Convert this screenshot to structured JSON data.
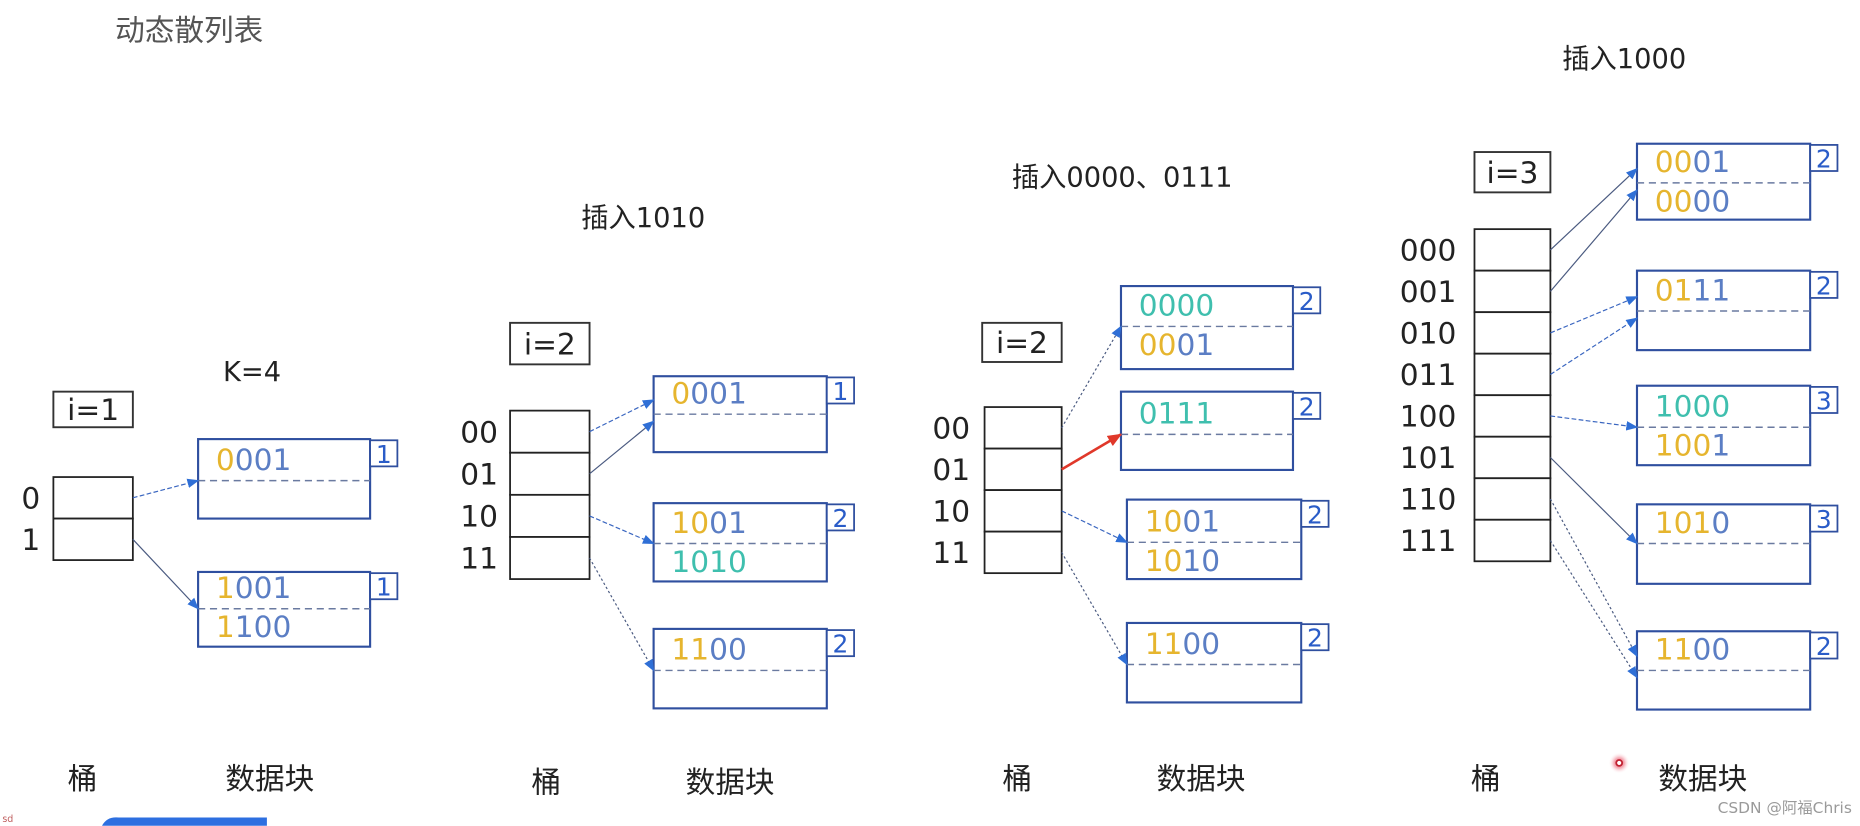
{
  "title": "动态散列表",
  "colors": {
    "prefix_bits": "#e6b52e",
    "other_bits": "#5b7ec4",
    "new_record": "#3fbfae",
    "block_border": "#2f4f9f",
    "depth_text": "#2a5cc8",
    "arrow": "#2f6fd6",
    "highlight_arrow": "#e0382a",
    "bucket_border": "#222222"
  },
  "panels": [
    {
      "title": "K=4",
      "global_depth": "i=1",
      "bucket_caption": "桶",
      "block_caption": "数据块",
      "buckets": [
        "0",
        "1"
      ],
      "blocks": [
        {
          "depth": "1",
          "records": [
            {
              "slot": 0,
              "segments": [
                {
                  "t": "0",
                  "c": "prefix"
                },
                {
                  "t": "001",
                  "c": "other"
                }
              ]
            }
          ]
        },
        {
          "depth": "1",
          "records": [
            {
              "slot": 0,
              "segments": [
                {
                  "t": "1",
                  "c": "prefix"
                },
                {
                  "t": "001",
                  "c": "other"
                }
              ]
            },
            {
              "slot": 1,
              "segments": [
                {
                  "t": "1",
                  "c": "prefix"
                },
                {
                  "t": "100",
                  "c": "other"
                }
              ]
            }
          ]
        }
      ],
      "pointers": [
        {
          "bucket": 0,
          "block": 0,
          "style": "dashed"
        },
        {
          "bucket": 1,
          "block": 1,
          "style": "solid"
        }
      ]
    },
    {
      "title": "插入1010",
      "global_depth": "i=2",
      "bucket_caption": "桶",
      "block_caption": "数据块",
      "buckets": [
        "00",
        "01",
        "10",
        "11"
      ],
      "blocks": [
        {
          "depth": "1",
          "records": [
            {
              "slot": 0,
              "segments": [
                {
                  "t": "0",
                  "c": "prefix"
                },
                {
                  "t": "001",
                  "c": "other"
                }
              ]
            }
          ]
        },
        {
          "depth": "2",
          "records": [
            {
              "slot": 0,
              "segments": [
                {
                  "t": "10",
                  "c": "prefix"
                },
                {
                  "t": "01",
                  "c": "other"
                }
              ]
            },
            {
              "slot": 1,
              "segments": [
                {
                  "t": "1010",
                  "c": "new"
                }
              ]
            }
          ]
        },
        {
          "depth": "2",
          "records": [
            {
              "slot": 0,
              "segments": [
                {
                  "t": "11",
                  "c": "prefix"
                },
                {
                  "t": "00",
                  "c": "other"
                }
              ]
            }
          ]
        }
      ],
      "pointers": [
        {
          "bucket": 0,
          "block": 0,
          "style": "dashed"
        },
        {
          "bucket": 1,
          "block": 0,
          "style": "solid"
        },
        {
          "bucket": 2,
          "block": 1,
          "style": "dashed"
        },
        {
          "bucket": 3,
          "block": 2,
          "style": "dotted"
        }
      ]
    },
    {
      "title": "插入0000、0111",
      "global_depth": "i=2",
      "bucket_caption": "桶",
      "block_caption": "数据块",
      "buckets": [
        "00",
        "01",
        "10",
        "11"
      ],
      "blocks": [
        {
          "depth": "2",
          "records": [
            {
              "slot": 0,
              "segments": [
                {
                  "t": "0000",
                  "c": "new"
                }
              ]
            },
            {
              "slot": 1,
              "segments": [
                {
                  "t": "00",
                  "c": "prefix"
                },
                {
                  "t": "01",
                  "c": "other"
                }
              ]
            }
          ]
        },
        {
          "depth": "2",
          "records": [
            {
              "slot": 0,
              "segments": [
                {
                  "t": "0111",
                  "c": "new"
                }
              ]
            }
          ]
        },
        {
          "depth": "2",
          "records": [
            {
              "slot": 0,
              "segments": [
                {
                  "t": "10",
                  "c": "prefix"
                },
                {
                  "t": "01",
                  "c": "other"
                }
              ]
            },
            {
              "slot": 1,
              "segments": [
                {
                  "t": "10",
                  "c": "prefix"
                },
                {
                  "t": "10",
                  "c": "other"
                }
              ]
            }
          ]
        },
        {
          "depth": "2",
          "records": [
            {
              "slot": 0,
              "segments": [
                {
                  "t": "11",
                  "c": "prefix"
                },
                {
                  "t": "00",
                  "c": "other"
                }
              ]
            }
          ]
        }
      ],
      "pointers": [
        {
          "bucket": 0,
          "block": 0,
          "style": "dotted"
        },
        {
          "bucket": 1,
          "block": 1,
          "style": "highlight"
        },
        {
          "bucket": 2,
          "block": 2,
          "style": "dashed"
        },
        {
          "bucket": 3,
          "block": 3,
          "style": "dotted"
        }
      ]
    },
    {
      "title": "插入1000",
      "global_depth": "i=3",
      "bucket_caption": "桶",
      "block_caption": "数据块",
      "buckets": [
        "000",
        "001",
        "010",
        "011",
        "100",
        "101",
        "110",
        "111"
      ],
      "blocks": [
        {
          "depth": "2",
          "records": [
            {
              "slot": 0,
              "segments": [
                {
                  "t": "00",
                  "c": "prefix"
                },
                {
                  "t": "01",
                  "c": "other"
                }
              ]
            },
            {
              "slot": 1,
              "segments": [
                {
                  "t": "00",
                  "c": "prefix"
                },
                {
                  "t": "00",
                  "c": "other"
                }
              ]
            }
          ]
        },
        {
          "depth": "2",
          "records": [
            {
              "slot": 0,
              "segments": [
                {
                  "t": "01",
                  "c": "prefix"
                },
                {
                  "t": "11",
                  "c": "other"
                }
              ]
            }
          ]
        },
        {
          "depth": "3",
          "records": [
            {
              "slot": 0,
              "segments": [
                {
                  "t": "1000",
                  "c": "new"
                }
              ]
            },
            {
              "slot": 1,
              "segments": [
                {
                  "t": "100",
                  "c": "prefix"
                },
                {
                  "t": "1",
                  "c": "other"
                }
              ]
            }
          ]
        },
        {
          "depth": "3",
          "records": [
            {
              "slot": 0,
              "segments": [
                {
                  "t": "101",
                  "c": "prefix"
                },
                {
                  "t": "0",
                  "c": "other"
                }
              ]
            }
          ]
        },
        {
          "depth": "2",
          "records": [
            {
              "slot": 0,
              "segments": [
                {
                  "t": "11",
                  "c": "prefix"
                },
                {
                  "t": "00",
                  "c": "other"
                }
              ]
            }
          ]
        }
      ],
      "pointers": [
        {
          "bucket": 0,
          "block": 0,
          "style": "solid"
        },
        {
          "bucket": 1,
          "block": 0,
          "style": "solid"
        },
        {
          "bucket": 2,
          "block": 1,
          "style": "dashed"
        },
        {
          "bucket": 3,
          "block": 1,
          "style": "dashed"
        },
        {
          "bucket": 4,
          "block": 2,
          "style": "dashed"
        },
        {
          "bucket": 5,
          "block": 3,
          "style": "solid"
        },
        {
          "bucket": 6,
          "block": 4,
          "style": "dotted"
        },
        {
          "bucket": 7,
          "block": 4,
          "style": "dotted"
        }
      ]
    }
  ],
  "watermark": "CSDN @阿福Chris",
  "corner_mark": "sd"
}
